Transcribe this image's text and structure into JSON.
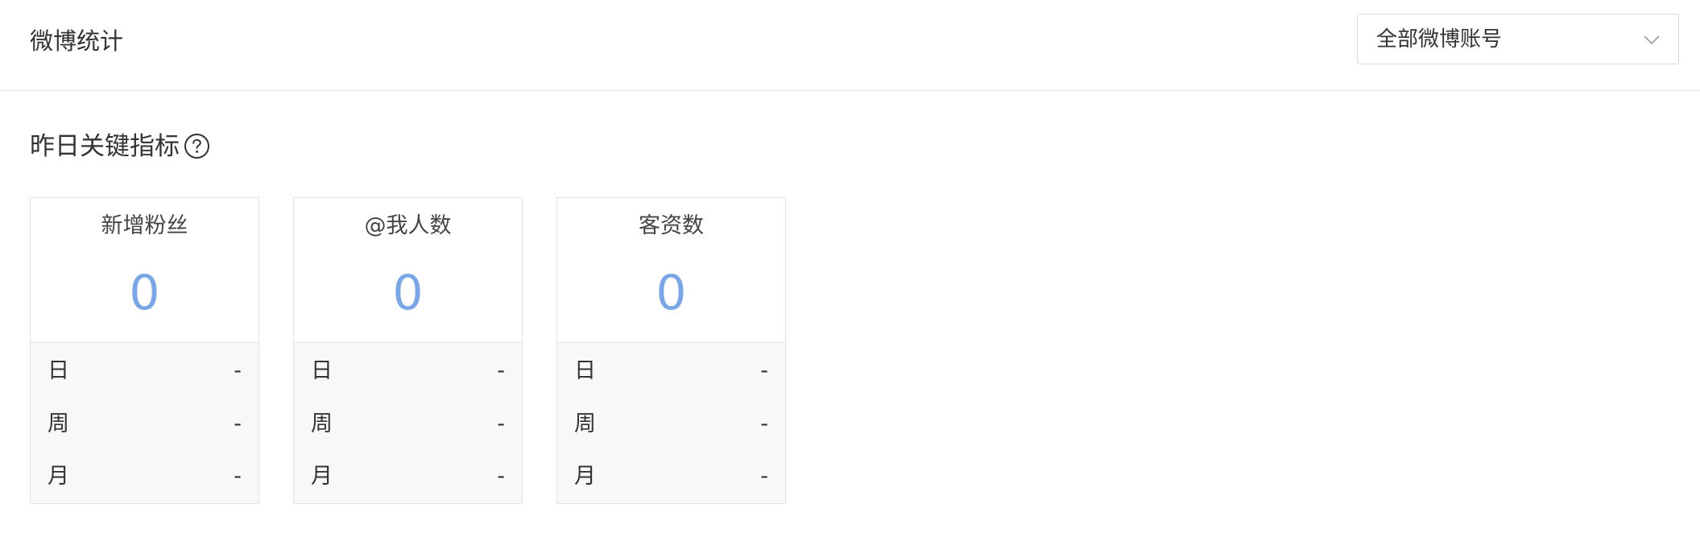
{
  "header": {
    "title": "微博统计",
    "account_select": {
      "value": "全部微博账号",
      "icon": "chevron-down-icon"
    }
  },
  "section": {
    "title": "昨日关键指标",
    "help_icon": "help-circle-icon"
  },
  "cards": [
    {
      "label": "新增粉丝",
      "value": "0",
      "rows": [
        {
          "k": "日",
          "v": "-"
        },
        {
          "k": "周",
          "v": "-"
        },
        {
          "k": "月",
          "v": "-"
        }
      ]
    },
    {
      "label": "@我人数",
      "value": "0",
      "rows": [
        {
          "k": "日",
          "v": "-"
        },
        {
          "k": "周",
          "v": "-"
        },
        {
          "k": "月",
          "v": "-"
        }
      ]
    },
    {
      "label": "客资数",
      "value": "0",
      "rows": [
        {
          "k": "日",
          "v": "-"
        },
        {
          "k": "周",
          "v": "-"
        },
        {
          "k": "月",
          "v": "-"
        }
      ]
    }
  ],
  "colors": {
    "value_blue": "#7aa6e6",
    "border": "#e3e3e3",
    "panel_bg": "#f8f8f8"
  }
}
